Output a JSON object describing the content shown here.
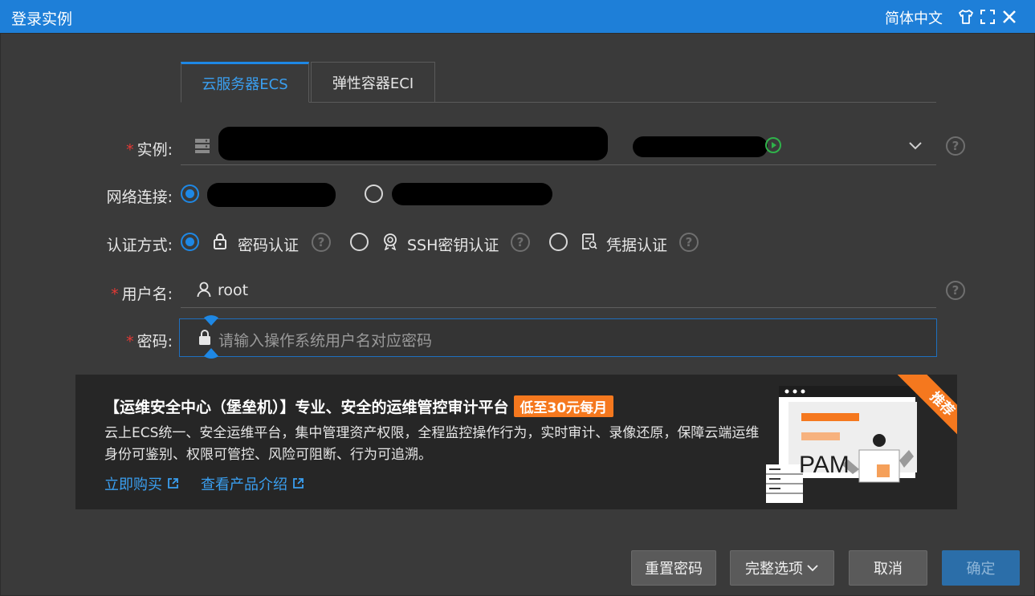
{
  "window": {
    "title": "登录实例",
    "language": "简体中文",
    "icons": [
      "shirt-icon",
      "fullscreen-icon",
      "close-icon"
    ]
  },
  "tabs": [
    {
      "label": "云服务器ECS",
      "active": true
    },
    {
      "label": "弹性容器ECI",
      "active": false
    }
  ],
  "form": {
    "instance": {
      "label": "实例:"
    },
    "network": {
      "label": "网络连接:"
    },
    "auth": {
      "label": "认证方式:",
      "options": [
        {
          "label": "密码认证",
          "selected": true,
          "icon": "lock-icon"
        },
        {
          "label": "SSH密钥认证",
          "selected": false,
          "icon": "badge-icon"
        },
        {
          "label": "凭据认证",
          "selected": false,
          "icon": "credential-icon"
        }
      ]
    },
    "username": {
      "label": "用户名:",
      "value": "root"
    },
    "password": {
      "label": "密码:",
      "placeholder": "请输入操作系统用户名对应密码"
    }
  },
  "promo": {
    "headline": "【运维安全中心（堡垒机）】专业、安全的运维管控审计平台",
    "badge": "低至30元每月",
    "description": "云上ECS统一、安全运维平台，集中管理资产权限，全程监控操作行为，实时审计、录像还原，保障云端运维身份可鉴别、权限可管控、风险可阻断、行为可追溯。",
    "link_buy": "立即购买",
    "link_intro": "查看产品介绍",
    "ribbon": "推荐",
    "illustration_text": "PAM"
  },
  "buttons": {
    "reset": "重置密码",
    "options": "完整选项",
    "cancel": "取消",
    "confirm": "确定"
  },
  "colors": {
    "titlebar": "#1e7fd8",
    "accent": "#1e88e5",
    "promo_orange": "#f5781e",
    "background": "#3a3a3a"
  }
}
